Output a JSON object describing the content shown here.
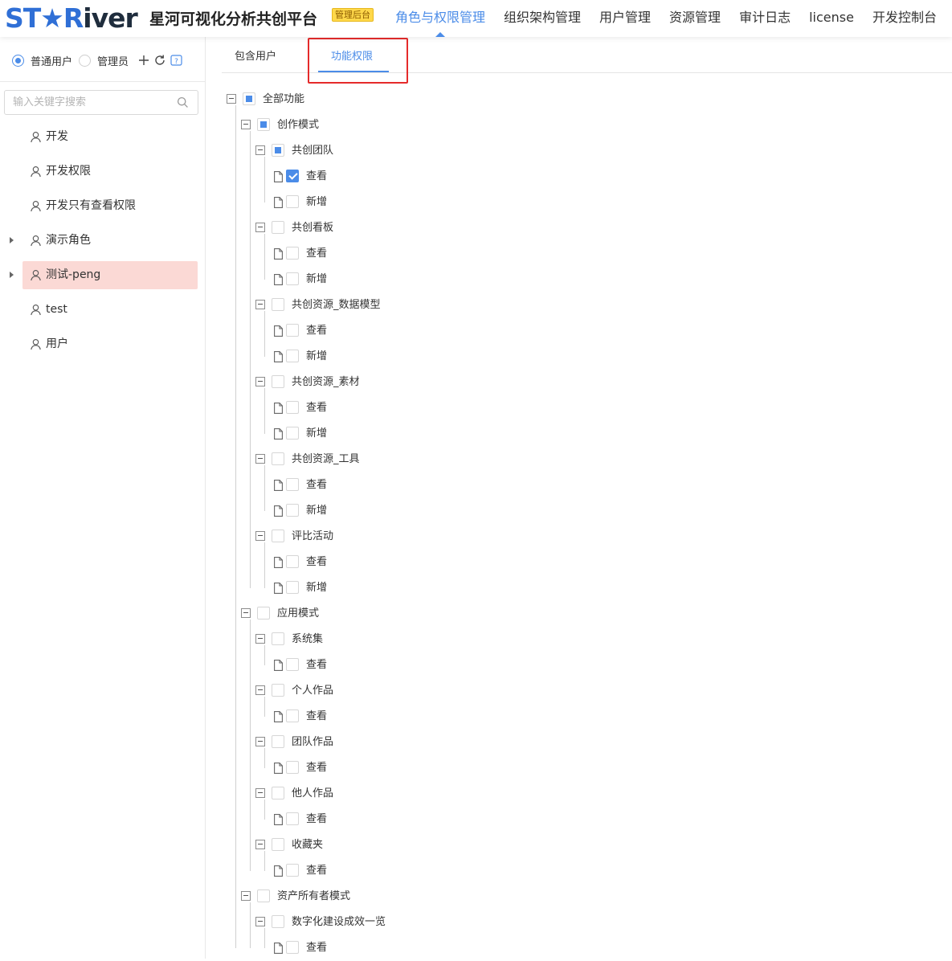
{
  "header": {
    "logo": {
      "part1": "ST",
      "star": "★",
      "part2": "R",
      "part3": "iver"
    },
    "platform_name": "星河可视化分析共创平台",
    "admin_badge": "管理后台",
    "nav": [
      {
        "label": "角色与权限管理",
        "active": true
      },
      {
        "label": "组织架构管理",
        "active": false
      },
      {
        "label": "用户管理",
        "active": false
      },
      {
        "label": "资源管理",
        "active": false
      },
      {
        "label": "审计日志",
        "active": false
      },
      {
        "label": "license",
        "active": false
      },
      {
        "label": "开发控制台",
        "active": false
      }
    ]
  },
  "sidebar": {
    "role_types": [
      {
        "label": "普通用户",
        "checked": true
      },
      {
        "label": "管理员",
        "checked": false
      }
    ],
    "tools": {
      "add": "+",
      "refresh": "↻",
      "help": "?"
    },
    "search": {
      "placeholder": "输入关键字搜索",
      "value": ""
    },
    "roles": [
      {
        "label": "开发",
        "has_children": false,
        "selected": false
      },
      {
        "label": "开发权限",
        "has_children": false,
        "selected": false
      },
      {
        "label": "开发只有查看权限",
        "has_children": false,
        "selected": false
      },
      {
        "label": "演示角色",
        "has_children": true,
        "selected": false
      },
      {
        "label": "测试-peng",
        "has_children": true,
        "selected": true
      },
      {
        "label": "test",
        "has_children": false,
        "selected": false
      },
      {
        "label": "用户",
        "has_children": false,
        "selected": false
      }
    ]
  },
  "main": {
    "tabs": [
      {
        "label": "包含用户",
        "active": false
      },
      {
        "label": "功能权限",
        "active": true
      }
    ],
    "tree": [
      {
        "label": "全部功能",
        "level": 0,
        "leaf": false,
        "state": "indeterminate"
      },
      {
        "label": "创作模式",
        "level": 1,
        "leaf": false,
        "state": "indeterminate"
      },
      {
        "label": "共创团队",
        "level": 2,
        "leaf": false,
        "state": "indeterminate"
      },
      {
        "label": "查看",
        "level": 3,
        "leaf": true,
        "state": "checked"
      },
      {
        "label": "新增",
        "level": 3,
        "leaf": true,
        "state": "unchecked"
      },
      {
        "label": "共创看板",
        "level": 2,
        "leaf": false,
        "state": "unchecked"
      },
      {
        "label": "查看",
        "level": 3,
        "leaf": true,
        "state": "unchecked"
      },
      {
        "label": "新增",
        "level": 3,
        "leaf": true,
        "state": "unchecked"
      },
      {
        "label": "共创资源_数据模型",
        "level": 2,
        "leaf": false,
        "state": "unchecked"
      },
      {
        "label": "查看",
        "level": 3,
        "leaf": true,
        "state": "unchecked"
      },
      {
        "label": "新增",
        "level": 3,
        "leaf": true,
        "state": "unchecked"
      },
      {
        "label": "共创资源_素材",
        "level": 2,
        "leaf": false,
        "state": "unchecked"
      },
      {
        "label": "查看",
        "level": 3,
        "leaf": true,
        "state": "unchecked"
      },
      {
        "label": "新增",
        "level": 3,
        "leaf": true,
        "state": "unchecked"
      },
      {
        "label": "共创资源_工具",
        "level": 2,
        "leaf": false,
        "state": "unchecked"
      },
      {
        "label": "查看",
        "level": 3,
        "leaf": true,
        "state": "unchecked"
      },
      {
        "label": "新增",
        "level": 3,
        "leaf": true,
        "state": "unchecked"
      },
      {
        "label": "评比活动",
        "level": 2,
        "leaf": false,
        "state": "unchecked"
      },
      {
        "label": "查看",
        "level": 3,
        "leaf": true,
        "state": "unchecked"
      },
      {
        "label": "新增",
        "level": 3,
        "leaf": true,
        "state": "unchecked"
      },
      {
        "label": "应用模式",
        "level": 1,
        "leaf": false,
        "state": "unchecked"
      },
      {
        "label": "系统集",
        "level": 2,
        "leaf": false,
        "state": "unchecked"
      },
      {
        "label": "查看",
        "level": 3,
        "leaf": true,
        "state": "unchecked"
      },
      {
        "label": "个人作品",
        "level": 2,
        "leaf": false,
        "state": "unchecked"
      },
      {
        "label": "查看",
        "level": 3,
        "leaf": true,
        "state": "unchecked"
      },
      {
        "label": "团队作品",
        "level": 2,
        "leaf": false,
        "state": "unchecked"
      },
      {
        "label": "查看",
        "level": 3,
        "leaf": true,
        "state": "unchecked"
      },
      {
        "label": "他人作品",
        "level": 2,
        "leaf": false,
        "state": "unchecked"
      },
      {
        "label": "查看",
        "level": 3,
        "leaf": true,
        "state": "unchecked"
      },
      {
        "label": "收藏夹",
        "level": 2,
        "leaf": false,
        "state": "unchecked"
      },
      {
        "label": "查看",
        "level": 3,
        "leaf": true,
        "state": "unchecked"
      },
      {
        "label": "资产所有者模式",
        "level": 1,
        "leaf": false,
        "state": "unchecked"
      },
      {
        "label": "数字化建设成效一览",
        "level": 2,
        "leaf": false,
        "state": "unchecked"
      },
      {
        "label": "查看",
        "level": 3,
        "leaf": true,
        "state": "unchecked"
      }
    ]
  },
  "colors": {
    "accent": "#4b8ce8",
    "selected_row": "#fbd9d5",
    "highlight_box": "#e52b2b",
    "badge": "#ffd84a",
    "logo_blue": "#2f6fd6",
    "logo_dark": "#1f2d3d"
  }
}
